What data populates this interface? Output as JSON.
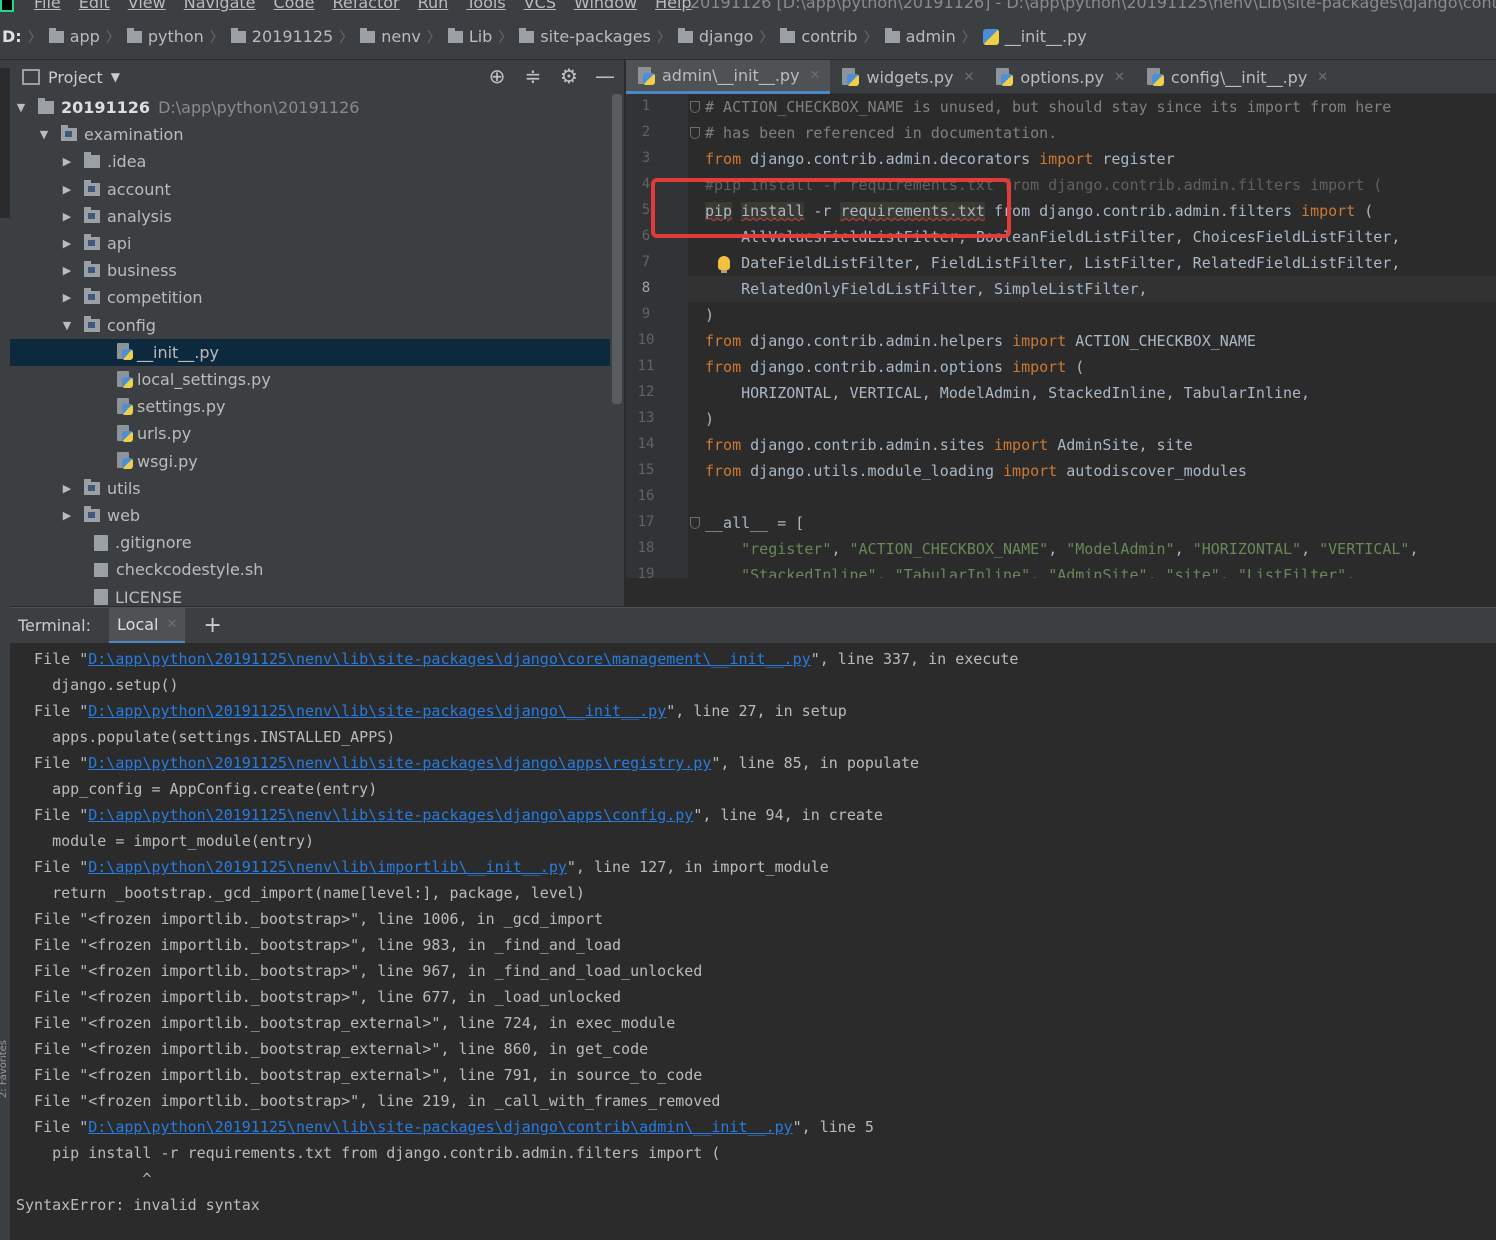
{
  "menu": {
    "items": [
      "File",
      "Edit",
      "View",
      "Navigate",
      "Code",
      "Refactor",
      "Run",
      "Tools",
      "VCS",
      "Window",
      "Help"
    ],
    "window_title": "20191126 [D:\\app\\python\\20191126] - D:\\app\\python\\20191125\\nenv\\Lib\\site-packages\\django\\contrib\\ad"
  },
  "breadcrumb": [
    "D:",
    "app",
    "python",
    "20191125",
    "nenv",
    "Lib",
    "site-packages",
    "django",
    "contrib",
    "admin",
    "__init__.py"
  ],
  "project_panel": {
    "title": "Project",
    "tree": [
      {
        "label": "20191126",
        "path": "D:\\app\\python\\20191126",
        "depth": 0,
        "type": "root",
        "expanded": true
      },
      {
        "label": "examination",
        "depth": 1,
        "type": "module",
        "expanded": true
      },
      {
        "label": ".idea",
        "depth": 2,
        "type": "folder",
        "expanded": false
      },
      {
        "label": "account",
        "depth": 2,
        "type": "module",
        "expanded": false
      },
      {
        "label": "analysis",
        "depth": 2,
        "type": "module",
        "expanded": false
      },
      {
        "label": "api",
        "depth": 2,
        "type": "module",
        "expanded": false
      },
      {
        "label": "business",
        "depth": 2,
        "type": "module",
        "expanded": false
      },
      {
        "label": "competition",
        "depth": 2,
        "type": "module",
        "expanded": false
      },
      {
        "label": "config",
        "depth": 2,
        "type": "module",
        "expanded": true
      },
      {
        "label": "__init__.py",
        "depth": 3,
        "type": "py",
        "selected": true
      },
      {
        "label": "local_settings.py",
        "depth": 3,
        "type": "py"
      },
      {
        "label": "settings.py",
        "depth": 3,
        "type": "py"
      },
      {
        "label": "urls.py",
        "depth": 3,
        "type": "py"
      },
      {
        "label": "wsgi.py",
        "depth": 3,
        "type": "py"
      },
      {
        "label": "utils",
        "depth": 2,
        "type": "module",
        "expanded": false
      },
      {
        "label": "web",
        "depth": 2,
        "type": "module",
        "expanded": false
      },
      {
        "label": ".gitignore",
        "depth": 2,
        "type": "txt"
      },
      {
        "label": "checkcodestyle.sh",
        "depth": 2,
        "type": "sh"
      },
      {
        "label": "LICENSE",
        "depth": 2,
        "type": "txt"
      }
    ]
  },
  "editor_tabs": [
    {
      "label": "admin\\__init__.py",
      "active": true
    },
    {
      "label": "widgets.py",
      "active": false
    },
    {
      "label": "options.py",
      "active": false
    },
    {
      "label": "config\\__init__.py",
      "active": false
    }
  ],
  "editor": {
    "current_line": 8,
    "lines": [
      [
        {
          "t": "# ACTION_CHECKBOX_NAME is unused, but should stay since its import from here",
          "c": "cm"
        }
      ],
      [
        {
          "t": "# has been referenced in documentation.",
          "c": "cm"
        }
      ],
      [
        {
          "t": "from",
          "c": "kw"
        },
        {
          "t": " django.contrib.admin.decorators "
        },
        {
          "t": "import",
          "c": "kw"
        },
        {
          "t": " register"
        }
      ],
      [
        {
          "t": "#pip install -r requirements.txt from django.contrib.admin.filters import (",
          "c": "dim"
        }
      ],
      [
        {
          "t": "pip",
          "c": "hlw"
        },
        {
          "t": " "
        },
        {
          "t": "install",
          "c": "hlw"
        },
        {
          "t": " -r "
        },
        {
          "t": "requirements.txt",
          "c": "hlw"
        },
        {
          "t": " from django.contrib.admin.filters "
        },
        {
          "t": "import",
          "c": "kw"
        },
        {
          "t": " ("
        }
      ],
      [
        {
          "t": "    AllValuesFieldListFilter, BooleanFieldListFilter, ChoicesFieldListFilter,"
        }
      ],
      [
        {
          "t": "    DateFieldListFilter, FieldListFilter, ListFilter, RelatedFieldListFilter,"
        }
      ],
      [
        {
          "t": "    RelatedOnlyFieldListFilter, SimpleListFilter,"
        }
      ],
      [
        {
          "t": ")"
        }
      ],
      [
        {
          "t": "from",
          "c": "kw"
        },
        {
          "t": " django.contrib.admin.helpers "
        },
        {
          "t": "import",
          "c": "kw"
        },
        {
          "t": " ACTION_CHECKBOX_NAME"
        }
      ],
      [
        {
          "t": "from",
          "c": "kw"
        },
        {
          "t": " django.contrib.admin.options "
        },
        {
          "t": "import",
          "c": "kw"
        },
        {
          "t": " ("
        }
      ],
      [
        {
          "t": "    HORIZONTAL, VERTICAL, ModelAdmin, StackedInline, TabularInline,"
        }
      ],
      [
        {
          "t": ")"
        }
      ],
      [
        {
          "t": "from",
          "c": "kw"
        },
        {
          "t": " django.contrib.admin.sites "
        },
        {
          "t": "import",
          "c": "kw"
        },
        {
          "t": " AdminSite, site"
        }
      ],
      [
        {
          "t": "from",
          "c": "kw"
        },
        {
          "t": " django.utils.module_loading "
        },
        {
          "t": "import",
          "c": "kw"
        },
        {
          "t": " autodiscover_modules"
        }
      ],
      [
        {
          "t": ""
        }
      ],
      [
        {
          "t": "__all__ = ["
        }
      ],
      [
        {
          "t": "    "
        },
        {
          "t": "\"register\"",
          "c": "str"
        },
        {
          "t": ", "
        },
        {
          "t": "\"ACTION_CHECKBOX_NAME\"",
          "c": "str"
        },
        {
          "t": ", "
        },
        {
          "t": "\"ModelAdmin\"",
          "c": "str"
        },
        {
          "t": ", "
        },
        {
          "t": "\"HORIZONTAL\"",
          "c": "str"
        },
        {
          "t": ", "
        },
        {
          "t": "\"VERTICAL\"",
          "c": "str"
        },
        {
          "t": ","
        }
      ],
      [
        {
          "t": "    "
        },
        {
          "t": "\"StackedInline\"",
          "c": "str"
        },
        {
          "t": ", "
        },
        {
          "t": "\"TabularInline\"",
          "c": "str"
        },
        {
          "t": ", "
        },
        {
          "t": "\"AdminSite\"",
          "c": "str"
        },
        {
          "t": ", "
        },
        {
          "t": "\"site\"",
          "c": "str"
        },
        {
          "t": ", "
        },
        {
          "t": "\"ListFilter\"",
          "c": "str"
        },
        {
          "t": ","
        }
      ]
    ]
  },
  "terminal": {
    "title": "Terminal:",
    "tab": "Local",
    "lines": [
      [
        {
          "t": "  File \""
        },
        {
          "t": "D:\\app\\python\\20191125\\nenv\\lib\\site-packages\\django\\core\\management\\__init__.py",
          "link": true
        },
        {
          "t": "\", line 337, in execute"
        }
      ],
      [
        {
          "t": "    django.setup()"
        }
      ],
      [
        {
          "t": "  File \""
        },
        {
          "t": "D:\\app\\python\\20191125\\nenv\\lib\\site-packages\\django\\__init__.py",
          "link": true
        },
        {
          "t": "\", line 27, in setup"
        }
      ],
      [
        {
          "t": "    apps.populate(settings.INSTALLED_APPS)"
        }
      ],
      [
        {
          "t": "  File \""
        },
        {
          "t": "D:\\app\\python\\20191125\\nenv\\lib\\site-packages\\django\\apps\\registry.py",
          "link": true
        },
        {
          "t": "\", line 85, in populate"
        }
      ],
      [
        {
          "t": "    app_config = AppConfig.create(entry)"
        }
      ],
      [
        {
          "t": "  File \""
        },
        {
          "t": "D:\\app\\python\\20191125\\nenv\\lib\\site-packages\\django\\apps\\config.py",
          "link": true
        },
        {
          "t": "\", line 94, in create"
        }
      ],
      [
        {
          "t": "    module = import_module(entry)"
        }
      ],
      [
        {
          "t": "  File \""
        },
        {
          "t": "D:\\app\\python\\20191125\\nenv\\lib\\importlib\\__init__.py",
          "link": true
        },
        {
          "t": "\", line 127, in import_module"
        }
      ],
      [
        {
          "t": "    return _bootstrap._gcd_import(name[level:], package, level)"
        }
      ],
      [
        {
          "t": "  File \"<frozen importlib._bootstrap>\", line 1006, in _gcd_import"
        }
      ],
      [
        {
          "t": "  File \"<frozen importlib._bootstrap>\", line 983, in _find_and_load"
        }
      ],
      [
        {
          "t": "  File \"<frozen importlib._bootstrap>\", line 967, in _find_and_load_unlocked"
        }
      ],
      [
        {
          "t": "  File \"<frozen importlib._bootstrap>\", line 677, in _load_unlocked"
        }
      ],
      [
        {
          "t": "  File \"<frozen importlib._bootstrap_external>\", line 724, in exec_module"
        }
      ],
      [
        {
          "t": "  File \"<frozen importlib._bootstrap_external>\", line 860, in get_code"
        }
      ],
      [
        {
          "t": "  File \"<frozen importlib._bootstrap_external>\", line 791, in source_to_code"
        }
      ],
      [
        {
          "t": "  File \"<frozen importlib._bootstrap>\", line 219, in _call_with_frames_removed"
        }
      ],
      [
        {
          "t": "  File \""
        },
        {
          "t": "D:\\app\\python\\20191125\\nenv\\lib\\site-packages\\django\\contrib\\admin\\__init__.py",
          "link": true
        },
        {
          "t": "\", line 5"
        }
      ],
      [
        {
          "t": "    pip install -r requirements.txt from django.contrib.admin.filters import ("
        }
      ],
      [
        {
          "t": "              ^"
        }
      ],
      [
        {
          "t": "SyntaxError: invalid syntax"
        }
      ]
    ]
  }
}
